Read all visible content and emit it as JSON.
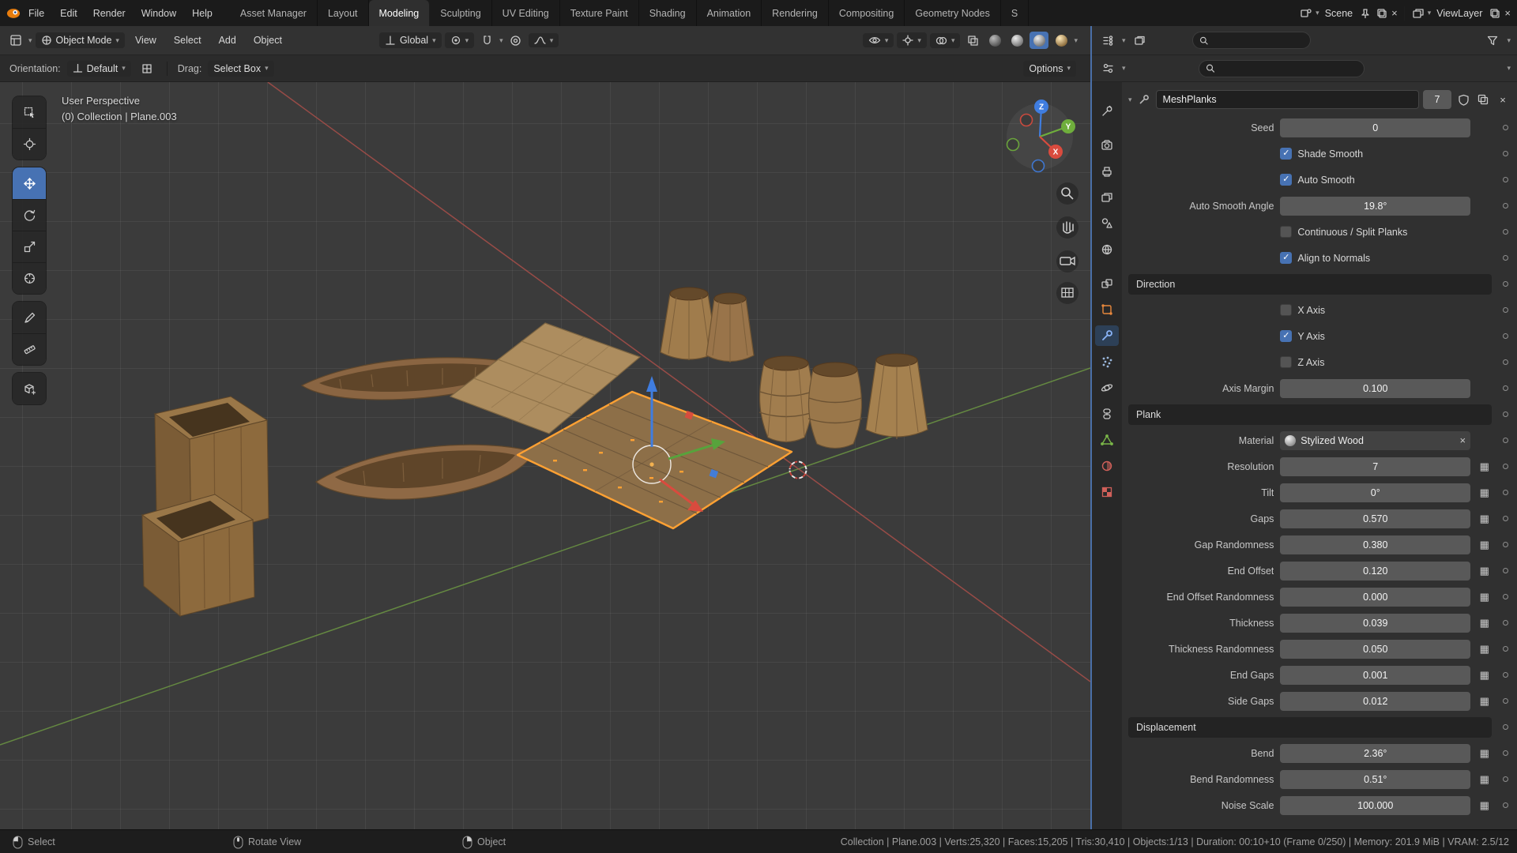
{
  "icons": {
    "chevron_down": "▾",
    "close": "×",
    "check": "✓",
    "attribute_grid": "▦"
  },
  "topbar": {
    "menus": [
      "File",
      "Edit",
      "Render",
      "Window",
      "Help"
    ],
    "workspaces": [
      "Asset Manager",
      "Layout",
      "Modeling",
      "Sculpting",
      "UV Editing",
      "Texture Paint",
      "Shading",
      "Animation",
      "Rendering",
      "Compositing",
      "Geometry Nodes",
      "S"
    ],
    "scene_label": "Scene",
    "viewlayer_label": "ViewLayer"
  },
  "viewport_header": {
    "mode_selector": "Object Mode",
    "menus": [
      "View",
      "Select",
      "Add",
      "Object"
    ],
    "transform_orientation": "Global"
  },
  "tool_settings": {
    "orientation_label": "Orientation:",
    "orientation_value": "Default",
    "drag_label": "Drag:",
    "drag_value": "Select Box",
    "options_button": "Options"
  },
  "viewport": {
    "view_label": "User Perspective",
    "context_label": "(0) Collection | Plane.003",
    "axis_x": "X",
    "axis_y": "Y",
    "axis_z": "Z"
  },
  "modifier": {
    "name": "MeshPlanks",
    "count": "7",
    "sections": {
      "direction": "Direction",
      "plank": "Plank",
      "displacement": "Displacement"
    },
    "rows": {
      "seed": {
        "label": "Seed",
        "value": "0"
      },
      "shade_smooth": {
        "label": "Shade Smooth",
        "checked": true
      },
      "auto_smooth": {
        "label": "Auto Smooth",
        "checked": true
      },
      "auto_smooth_angle": {
        "label": "Auto Smooth Angle",
        "value": "19.8°"
      },
      "continuous_split": {
        "label": "Continuous / Split Planks",
        "checked": false
      },
      "align_to_normals": {
        "label": "Align to Normals",
        "checked": true
      },
      "x_axis": {
        "label": "X Axis",
        "checked": false
      },
      "y_axis": {
        "label": "Y Axis",
        "checked": true
      },
      "z_axis": {
        "label": "Z Axis",
        "checked": false
      },
      "axis_margin": {
        "label": "Axis Margin",
        "value": "0.100"
      },
      "material": {
        "label": "Material",
        "value": "Stylized Wood"
      },
      "resolution": {
        "label": "Resolution",
        "value": "7"
      },
      "tilt": {
        "label": "Tilt",
        "value": "0°"
      },
      "gaps": {
        "label": "Gaps",
        "value": "0.570"
      },
      "gap_randomness": {
        "label": "Gap Randomness",
        "value": "0.380"
      },
      "end_offset": {
        "label": "End Offset",
        "value": "0.120"
      },
      "end_offset_randomness": {
        "label": "End Offset Randomness",
        "value": "0.000"
      },
      "thickness": {
        "label": "Thickness",
        "value": "0.039"
      },
      "thickness_randomness": {
        "label": "Thickness Randomness",
        "value": "0.050"
      },
      "end_gaps": {
        "label": "End Gaps",
        "value": "0.001"
      },
      "side_gaps": {
        "label": "Side Gaps",
        "value": "0.012"
      },
      "bend": {
        "label": "Bend",
        "value": "2.36°"
      },
      "bend_randomness": {
        "label": "Bend Randomness",
        "value": "0.51°"
      },
      "noise_scale": {
        "label": "Noise Scale",
        "value": "100.000"
      }
    }
  },
  "statusbar": {
    "select_label": "Select",
    "rotate_view_label": "Rotate View",
    "object_label": "Object",
    "stats": "Collection | Plane.003 | Verts:25,320 | Faces:15,205 | Tris:30,410 | Objects:1/13 | Duration: 00:10+10 (Frame 0/250) | Memory: 201.9 MiB | VRAM: 2.5/12"
  },
  "colors": {
    "accent_blue": "#4772b3",
    "selection_orange": "#ffa133",
    "axis_x_red": "#d94b3e",
    "axis_y_green": "#6fae3c",
    "axis_z_blue": "#3f7de0"
  }
}
